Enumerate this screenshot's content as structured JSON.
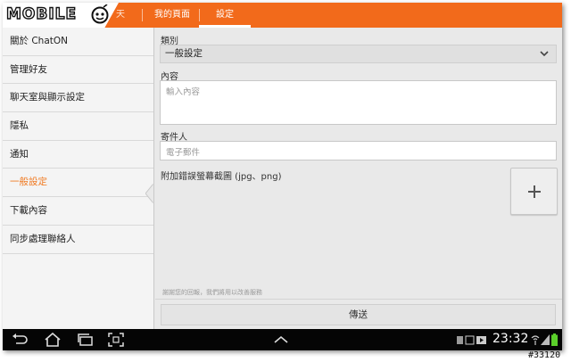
{
  "logo": {
    "text": "MOBILE"
  },
  "tabs": [
    {
      "label": "天",
      "active": false
    },
    {
      "label": "我的頁面",
      "active": false
    },
    {
      "label": "設定",
      "active": true
    }
  ],
  "sidebar": {
    "items": [
      {
        "label": "關於 ChatON"
      },
      {
        "label": "管理好友"
      },
      {
        "label": "聊天室與顯示設定"
      },
      {
        "label": "隱私"
      },
      {
        "label": "通知"
      },
      {
        "label": "一般設定",
        "active": true
      },
      {
        "label": "下載內容"
      },
      {
        "label": "同步處理聯絡人"
      }
    ]
  },
  "form": {
    "category_label": "類別",
    "category_value": "一般設定",
    "content_label": "內容",
    "content_placeholder": "輸入內容",
    "sender_label": "寄件人",
    "sender_placeholder": "電子郵件",
    "attach_label": "附加錯誤螢幕截圖 (jpg、png)",
    "notice": "謝謝您的回報，我們將用以改善服務",
    "send_label": "傳送"
  },
  "status": {
    "time": "23:32"
  },
  "watermark": "#33120",
  "colors": {
    "accent": "#f26a1b",
    "active_text": "#f07a22"
  }
}
